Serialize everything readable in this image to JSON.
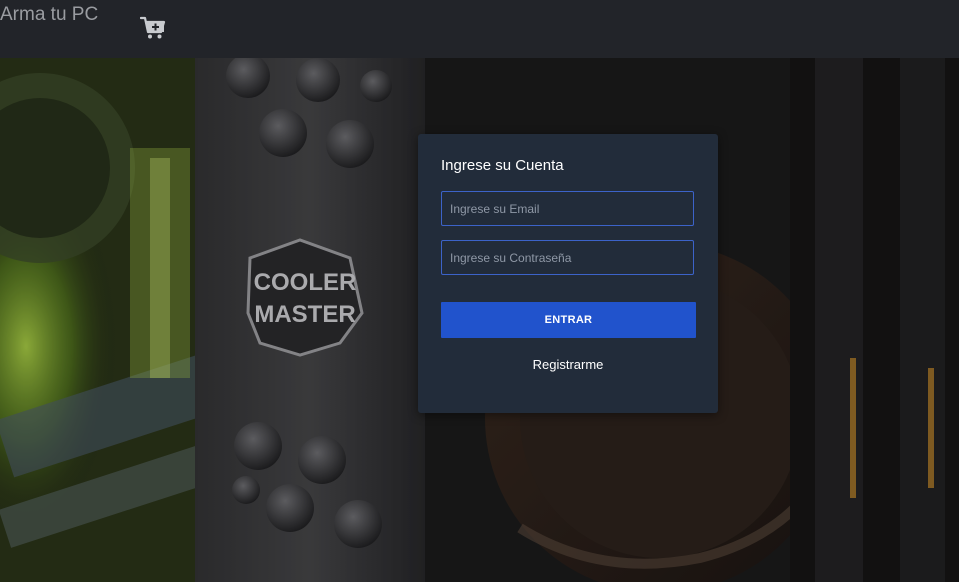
{
  "navbar": {
    "brand": "Arma tu PC",
    "cart_icon": "cart-plus-icon"
  },
  "background": {
    "logo_text_line1": "COOLER",
    "logo_text_line2": "MASTER",
    "accent_color": "#8fd13a"
  },
  "login": {
    "title": "Ingrese su Cuenta",
    "email_placeholder": "Ingrese su Email",
    "email_value": "",
    "password_placeholder": "Ingrese su Contraseña",
    "password_value": "",
    "submit_label": "ENTRAR",
    "register_label": "Registrarme",
    "button_color": "#2153cc",
    "card_color": "#222c3a"
  }
}
